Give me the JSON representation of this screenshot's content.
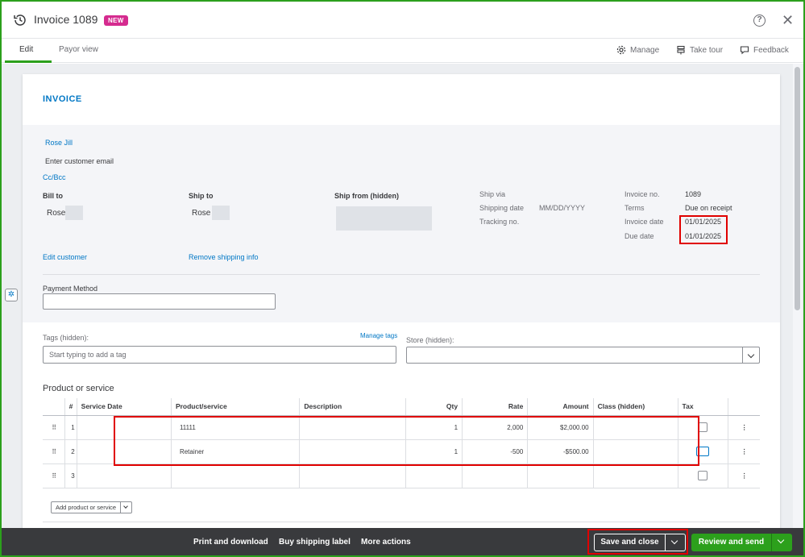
{
  "header": {
    "title": "Invoice 1089",
    "badge": "NEW"
  },
  "tabs": [
    {
      "label": "Edit",
      "active": true
    },
    {
      "label": "Payor view",
      "active": false
    }
  ],
  "toolbar": {
    "manage": "Manage",
    "take_tour": "Take tour",
    "feedback": "Feedback"
  },
  "invoice": {
    "heading": "INVOICE",
    "customer_name": "Rose Jill",
    "email_placeholder": "Enter customer email",
    "cc_bcc": "Cc/Bcc",
    "bill_to_label": "Bill to",
    "bill_to_value": "Rose",
    "ship_to_label": "Ship to",
    "ship_to_value": "Rose",
    "ship_from_label": "Ship from (hidden)",
    "ship_via_label": "Ship via",
    "shipping_date_label": "Shipping date",
    "shipping_date_placeholder": "MM/DD/YYYY",
    "tracking_label": "Tracking no.",
    "invoice_no_label": "Invoice no.",
    "invoice_no_value": "1089",
    "terms_label": "Terms",
    "terms_value": "Due on receipt",
    "invoice_date_label": "Invoice date",
    "invoice_date_value": "01/01/2025",
    "due_date_label": "Due date",
    "due_date_value": "01/01/2025",
    "edit_customer": "Edit customer",
    "remove_shipping": "Remove shipping info",
    "payment_method_label": "Payment Method",
    "payment_method_value": "",
    "tags_label": "Tags (hidden):",
    "manage_tags": "Manage tags",
    "tags_placeholder": "Start typing to add a tag",
    "store_label": "Store (hidden):",
    "store_value": ""
  },
  "products": {
    "section_title": "Product or service",
    "columns": [
      "#",
      "Service Date",
      "Product/service",
      "Description",
      "Qty",
      "Rate",
      "Amount",
      "Class (hidden)",
      "Tax"
    ],
    "rows": [
      {
        "num": "1",
        "service_date": "",
        "product": "11111",
        "description": "",
        "qty": "1",
        "rate": "2,000",
        "amount": "$2,000.00",
        "class": "",
        "tax": false
      },
      {
        "num": "2",
        "service_date": "",
        "product": "Retainer",
        "description": "",
        "qty": "1",
        "rate": "-500",
        "amount": "-$500.00",
        "class": "",
        "tax": false
      },
      {
        "num": "3",
        "service_date": "",
        "product": "",
        "description": "",
        "qty": "",
        "rate": "",
        "amount": "",
        "class": "",
        "tax": false
      }
    ],
    "add_button": "Add product or service"
  },
  "footer": {
    "print_download": "Print and download",
    "buy_shipping": "Buy shipping label",
    "more_actions": "More actions",
    "save_close": "Save and close",
    "review_send": "Review and send"
  },
  "colors": {
    "brand_green": "#2ca01c",
    "link_blue": "#0077c5",
    "badge_pink": "#d52b8f",
    "highlight_red": "#e00000",
    "footer_dark": "#393a3d"
  }
}
